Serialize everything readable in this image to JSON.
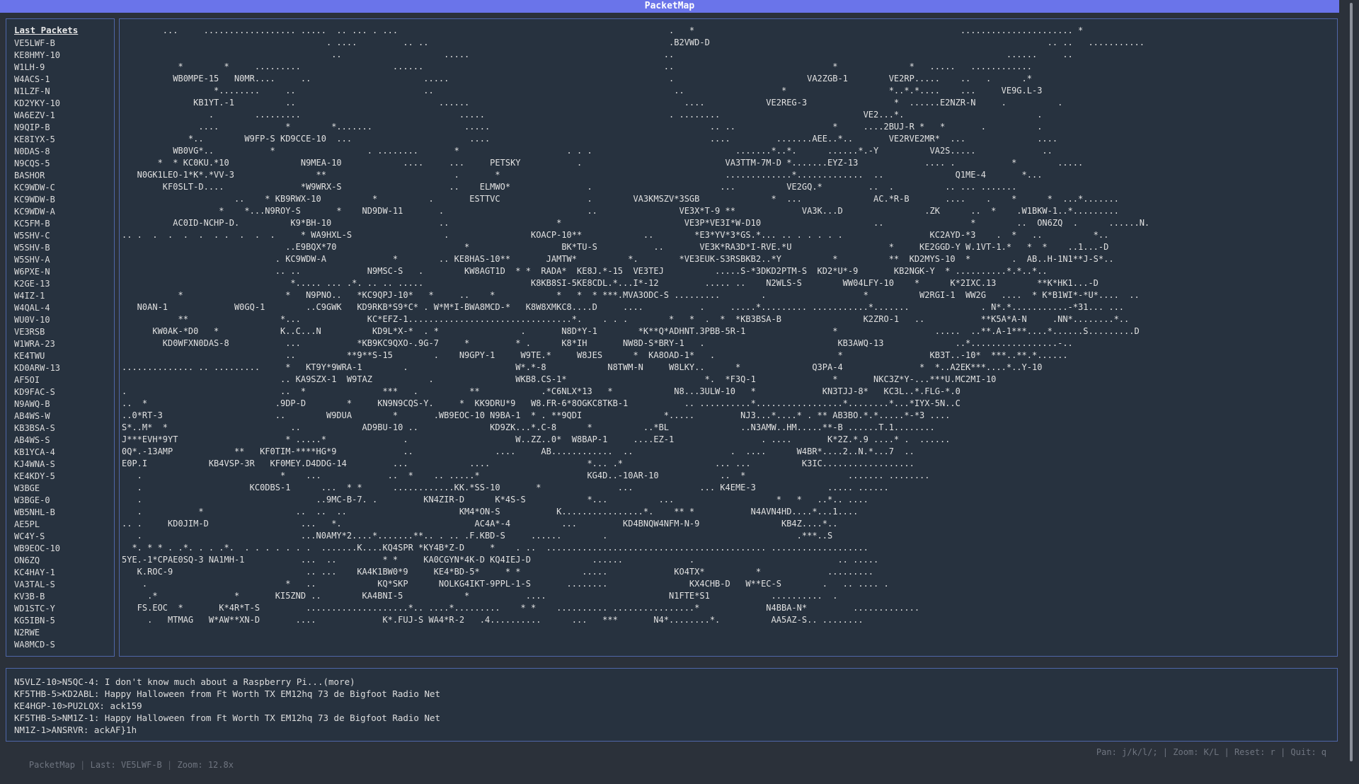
{
  "app": {
    "title": "PacketMap"
  },
  "sidebar": {
    "title": "Last Packets",
    "items": [
      "VE5LWF-B",
      "KE8HMY-10",
      "W1LH-9",
      "W4ACS-1",
      "N1LZF-N",
      "KD2YKY-10",
      "WA6EZV-1",
      "N9QIP-B",
      "KE8IYX-5",
      "N0DAS-8",
      "N9CQS-5",
      "BASHOR",
      "KC9WDW-C",
      "KC9WDW-B",
      "KC9WDW-A",
      "KC5FM-B",
      "W5SHV-C",
      "W5SHV-B",
      "W5SHV-A",
      "W6PXE-N",
      "K2GE-13",
      "W4IZ-1",
      "W4QAL-4",
      "WU0V-10",
      "VE3RSB",
      "W1WRA-23",
      "KE4TWU",
      "KD0ARW-13",
      "AF5OI",
      "KD9FAC-S",
      "N9AWQ-B",
      "AB4WS-W",
      "KB3BSA-S",
      "AB4WS-S",
      "KB1YCA-4",
      "KJ4WNA-S",
      "KE4KDY-5",
      "W3BGE",
      "W3BGE-0",
      "WB5NHL-B",
      "AE5PL",
      "WC4Y-S",
      "WB9EOC-10",
      "ON6ZQ",
      "KC4HAY-1",
      "VA3TAL-S",
      "KV3B-B",
      "WD1STC-Y",
      "KG5IBN-5",
      "N2RWE",
      "WA8MCD-S"
    ]
  },
  "map": {
    "lines": [
      "        ...     .................. .....  .. ... . ...                                                     .   *                                                    ...................... *",
      "                                        . ....         .. ..                                               .B2VWD-D                                                                  .. ..   ...........",
      "                                         ..                    .....                                      ..                                                                 ......     ..",
      "           *        *     .........                  ......                                               ..                               *              *   .....   ............",
      "          WB0MPE-15   N0MR....     ..                      .....                                           .                          VA2ZGB-1        VE2RP.....    ..   .      .*",
      "                  *........     ..                         ..                                               ..                   *                    *..*.*....    ...     VE9G.L-3",
      "              KB1YT.-1          ..                            ......                                          ....            VE2REG-3                 *  ......E2NZR-N     .          .",
      "                 .        .........                               .....                                    . ........                            VE2...*.                          .",
      "               ....             *        *.......                  .....                                           .. ..                   *     ....2BUJ-R *   *       .          .",
      "             *..        W9FP-S KD9CCE-10  ...                       ....                                           ....         .......AEE..*..       VE2RVE2MR*  ...              ....",
      "          WB0VG*..           *                  . ........       *                     . . .                            .......*..*.      ......*.-Y          VA2S.....             ..",
      "       *  * KC0KU.*10              N9MEA-10            ....     ...     PETSKY           .                            VA3TTM-7M-D *.......EYZ-13             .... .           *        .....",
      "   N0GK1LEO-1*K*.*VV-3                **                         .       *                                            .............*.............  ..              Q1ME-4       *...",
      "        KF0SLT-D....               *W9WRX-S                     ..    ELMWO*               .                         ...          VE2GQ.*         ..  .          .. ... .......",
      "                      ..    * KB9RWX-10          *          .       ESTTVC                 .        VA3KMSZV*3SGB              *  ...              AC.*R-B       ....    .    *      *  ...*.......",
      "                   *    *...N9ROY-S       *    ND9DW-11       .                            ..                VE3X*T-9 **             VA3K...D                .ZK      ..  *    .W1BKW-1..*.........",
      "          AC0ID-NCHP-D.          K9*BH-10                     ..                     *                        VE3P*VE3I*W-D10                      ..                 *        ..  ON6ZQ  .      ......N.",
      ".. .  .  .  .  .  . .  .  .  .     * WA9HXL-S                  .                KOACP-10**            ..        *E3*YV*3*GS.*... .. . . . . .                 KC2AYD-*3    .  *   ..          *..",
      "                                ..E9BQX*70                         *                  BK*TU-S           ..       VE3K*RA3D*I-RVE.*U                   *     KE2GGD-Y W.1VT-1.*   *  *    ..1...-D",
      "                              . KC9WDW-A             *        .. KE8HAS-10**       JAMTW*          *.        *VE3EUK-S3RSBKB2..*Y          *          **  KD2MYS-10  *        .  AB..H-1N1**J-S*..",
      "                              .. ..             N9MSC-S   .        KW8AGT1D  * *  RADA*  KE8J.*-15  VE3TEJ          .....S-*3DKD2PTM-S  KD2*U*-9       KB2NGK-Y  * ..........*.*..*..",
      "                                 *..... ... .*. .. .. .....                     K8KB8SI-5KE8CDL.*...I*-12         ..... ..    N2WLS-S        WW04LFY-10    *      K*2IXC.13        **K*HK1...-D",
      "           *                    *   N9PNO..   *KC9QPJ-10*   *     ..    *            *   *  * ***.MVA3ODC-S .........        .                   *          W2RGI-1  WW2G   ....  * K*B1WI*-*U*....  ..",
      "   N0AN-1             W0GQ-1        ..C9GWK   KD9RKB*S9*C* . W*M*I-BWA8MCD-*   K8W8XMKC8....D     ....           .     .....*......... ...........*.......              . N*.*...........-*31... ...",
      "           **                  *...             KC*EFZ-1................................*.    . . .        *   *  .  *  *KB3BSA-B                K2ZRO-1   ..           **K5A*A-N     .NN*........*..",
      "      KW0AK-*D0   *            K..C...N          KD9L*X-*  . *                .       N8D*Y-1        *K**Q*ADHNT.3PBB-5R-1                 *                   .....  ..**.A-1***....*......S.........D",
      "        KD0WFXN0DAS-8           ...           *KB9KC9QXO-.9G-7     *         * .      K8*IH       NW8D-S*BRY-1   .                          KB3AWQ-13              ..*.................-..",
      "                                ..          **9**S-15        .    N9GPY-1     W9TE.*     W8JES      *  KA8OAD-1*   .                        *                 KB3T..-10*  ***..**.*......",
      ".............. .. .........     *   KT9Y*9WRA-1        .                     W*.*-8            N8TWM-N     W8LKY..      *              Q3PA-4               *  *..A2EK***....*..Y-10",
      "                               .. KA9SZX-1  W9TAZ           .                WKB8.CS-1*                           *.  *F3Q-1               *       NKC3Z*Y-...***U.MC2MI-10",
      ".                              ..  *               ***   .          **            .*C6NLX*13   *            N8...3ULW-10   *             KN3TJJ-8*   KC3L..*.FLG-*.0",
      "..  *                         .9DP-D        *     KN9N9CQS-Y.     *  KK9DRU*9   W8.FR-6*8OGKC8TKB-1           .. ..........*.................*........*...*IYX-5N..C",
      "..0*RT-3                      ..        W9DUA        *       .WB9EOC-10 N9BA-1  * . **9QDI                *.....         NJ3...*....* . ** AB3BO.*.*.....*-*3 ....",
      "S*..M*  *                        ..            AD9BU-10 ..              KD9ZK...*.C-8      *          ..*BL              ..N3AMW..HM.....**-B ......T.1........",
      "J***EVH*9YT                     * .....*               .                     W..ZZ..0*  W8BAP-1     ....EZ-1                 . ....       K*2Z.*.9 ....* .  ......",
      "0Q*.-13AMP            **   KF0TIM-****HG*9             ..                ....     AB............  ..                   .  ....      W4BR*....2..N.*...7  ..",
      "E0P.I            KB4VSP-3R   KF0MEY.D4DDG-14         ...            ....                   *... .*                  ... ...          K3IC..................",
      "   .                           *    ...             ..  *    .. .....*                     KG4D..-10AR-10            ..  *                    ....... ........",
      "   .                     KC0DBS-1      ...  * *      ............KK.*SS-10       *               ...             ... K4EME-3              ..... ......",
      "   .                                  ..9MC-B-7. .         KN4ZIR-D      K*4S-S            *...          ...                    *   *   ..*.. ....",
      "   .           *                  ..  ..  ..                      KM4*ON-S           K................*.    ** *           N4AVN4HD....*...1....",
      ".. .     KD0JIM-D                  ...   *.                          AC4A*-4          ...         KD4BNQW4NFM-N-9                KB4Z....*..",
      "   .                               ...N0AMY*2....*.......**.. . .. .F.KBD-S     ......        .                                     .***..S",
      "  *. * * . .*. . . .*.  . . . . . . .  .......K....KQ4SPR *KY4B*Z-D     *    . ..  ........................................... ...................",
      "5YE.-1*CPAE0SQ-3 NA1MH-1           ...  ..         * *     KA0CGYN*4K-D KQ4IEJ-D            ......             .                            .. .....",
      "   K.ROC-9                          .. ...    KA4K1BW0*9     KE4*BD-5*     * *            .....             KO4TX*          *             .........",
      "    .                           *   ..            KQ*SKP      NOLKG4IKT-9PPL-1-S       ........                KX4CHB-D   W**EC-S        .   .. .... .",
      "     .*               *       KI5ZND ..        KA4BNI-5            *           ....                        N1FTE*S1            ..........  .",
      "   FS.EOC  *       K*4R*T-S         ....................*.. ....*.........    * *    .......... ................*             N4BBA-N*         .............",
      "     .   MTMAG   W*AW**XN-D       ....             K*.FUJ-S WA4*R-2   .4..........      ...   ***       N4*........*.          AA5AZ-S.. ........"
    ]
  },
  "messages": {
    "items": [
      "N5VLZ-10>N5QC-4: I don't know much about a Raspberry Pi...(more)",
      "KF5THB-5>KD2ABL: Happy Halloween from Ft Worth TX EM12hq 73 de Bigfoot Radio Net",
      "KE4HGP-10>PU2LQX: ack159",
      "KF5THB-5>NM1Z-1: Happy Halloween from Ft Worth TX EM12hq 73 de Bigfoot Radio Net",
      "NM1Z-1>ANSRVR: ackAF}1h"
    ]
  },
  "status": {
    "app": "PacketMap",
    "last": "Last: VE5LWF-B",
    "zoom": "Zoom: 12.8x",
    "help": "Pan: j/k/l/; | Zoom: K/L | Reset: r | Quit: q"
  },
  "colors": {
    "titlebar": "#6a74ea",
    "panel_border": "#4f66a8",
    "background": "#2b313a"
  }
}
